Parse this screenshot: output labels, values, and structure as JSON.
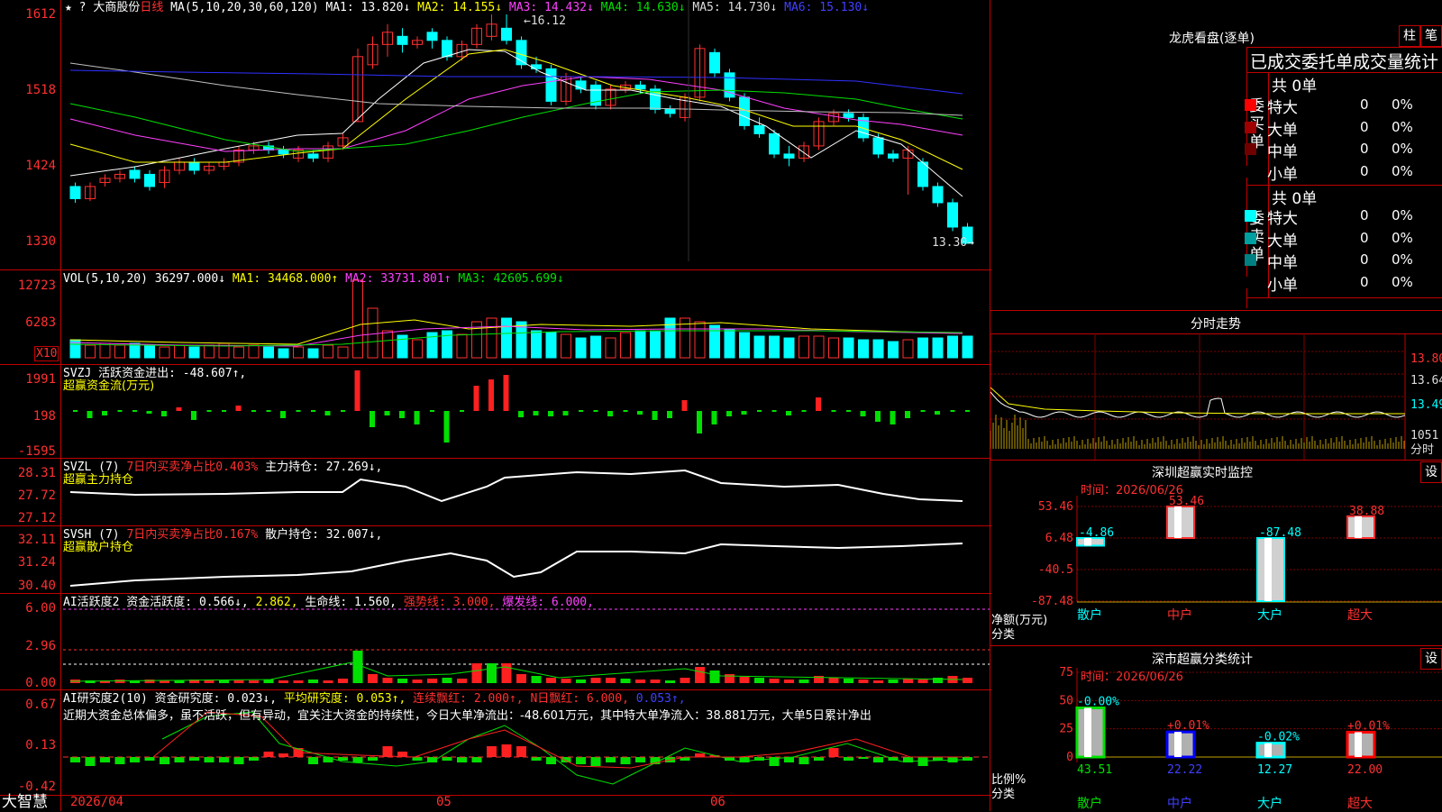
{
  "stock": {
    "name": "大商股份",
    "period": "日线",
    "brand": "大智慧",
    "date_label": "2026/04",
    "month_5": "05",
    "month_6": "06"
  },
  "main": {
    "ma_label": "MA(5,10,20,30,60,120)",
    "ma1": "MA1: 13.820↓",
    "ma2": "MA2: 14.155↓",
    "ma3": "MA3: 14.432↓",
    "ma4": "MA4: 14.630↓",
    "ma5": "MA5: 14.730↓",
    "ma6": "MA6: 15.130↓",
    "axis": [
      "1612",
      "1518",
      "1424",
      "1330"
    ],
    "high_label": "16.12",
    "low_label": "13.30"
  },
  "vol": {
    "label": "VOL(5,10,20)",
    "value": "36297.000↓",
    "ma1": "MA1: 34468.000↑",
    "ma2": "MA2: 33731.801↑",
    "ma3": "MA3: 42605.699↓",
    "axis": [
      "12723",
      "6283"
    ],
    "unit": "X10"
  },
  "svzj": {
    "label": "SVZJ  活跃资金进出: -48.607↑,",
    "sub": "超赢资金流(万元)",
    "axis": [
      "1991",
      "198",
      "-1595"
    ]
  },
  "svzl": {
    "label": "SVZL (7)",
    "desc": "7日内买卖净占比0.403%",
    "value": "主力持仓: 27.269↓,",
    "sub": "超赢主力持仓",
    "axis": [
      "28.31",
      "27.72",
      "27.12"
    ]
  },
  "svsh": {
    "label": "SVSH (7)",
    "desc": "7日内买卖净占比0.167%",
    "value": "散户持仓: 32.007↓,",
    "sub": "超赢散户持仓",
    "axis": [
      "32.11",
      "31.24",
      "30.40"
    ]
  },
  "ai1": {
    "label": "AI活跃度2 资金活跃度: 0.566↓,",
    "v2": "2.862,",
    "life": "生命线: 1.560,",
    "strong": "强势线: 3.000,",
    "burst": "爆发线: 6.000,",
    "axis": [
      "6.00",
      "2.96",
      "0.00"
    ]
  },
  "ai2": {
    "label": "AI研究度2(10) 资金研究度: 0.023↓,",
    "avg": "平均研究度: 0.053↑,",
    "cont": "连续飘红: 2.000↑,",
    "nday": "N日飘红: 6.000,",
    "last": "0.053↑,",
    "axis": [
      "0.67",
      "0.13",
      "-0.42"
    ],
    "comment": "近期大资金总体偏多，虽不活跃，但有异动，宜关注大资金的持续性，今日大单净流出：-48.601万元，其中特大单净流入：38.881万元，大单5日累计净出"
  },
  "dragon": {
    "title": "龙虎看盘(逐单)",
    "btn_pillar": "柱",
    "btn_pen": "笔",
    "heading": "已成交委托单成交量统计",
    "buy_label": "委买单",
    "sell_label": "委卖单",
    "buy_total": "共 0单",
    "sell_total": "共 0单",
    "buy_rows": [
      {
        "name": "特大",
        "count": "0",
        "pct": "0%",
        "color": "#ff0000"
      },
      {
        "name": "大单",
        "count": "0",
        "pct": "0%",
        "color": "#a00000"
      },
      {
        "name": "中单",
        "count": "0",
        "pct": "0%",
        "color": "#700000"
      },
      {
        "name": "小单",
        "count": "0",
        "pct": "0%",
        "color": "#000000"
      }
    ],
    "sell_rows": [
      {
        "name": "特大",
        "count": "0",
        "pct": "0%",
        "color": "#00ffff"
      },
      {
        "name": "大单",
        "count": "0",
        "pct": "0%",
        "color": "#00a0a0"
      },
      {
        "name": "中单",
        "count": "0",
        "pct": "0%",
        "color": "#008080"
      },
      {
        "name": "小单",
        "count": "0",
        "pct": "0%",
        "color": "#000000"
      }
    ]
  },
  "intraday": {
    "title": "分时走势",
    "axis": [
      "13.80",
      "13.64",
      "13.49"
    ],
    "vol_label": "1051",
    "vol_unit": "分时"
  },
  "monitor": {
    "title": "深圳超赢实时监控",
    "btn": "设",
    "time": "时间：2026/06/26",
    "axis": [
      "53.46",
      "6.48",
      "-40.5",
      "-87.48"
    ],
    "y_unit": "净额(万元)",
    "x_unit": "分类",
    "bars": [
      {
        "cat": "散户",
        "value": -4.86,
        "label": "-4.86"
      },
      {
        "cat": "中户",
        "value": 53.46,
        "label": "53.46"
      },
      {
        "cat": "大户",
        "value": -87.48,
        "label": "-87.48"
      },
      {
        "cat": "超大",
        "value": 38.88,
        "label": "38.88"
      }
    ]
  },
  "classstat": {
    "title": "深市超赢分类统计",
    "btn": "设",
    "time": "时间：2026/06/26",
    "axis": [
      "75",
      "50",
      "25",
      "0"
    ],
    "y_unit": "比例%",
    "x_unit": "分类",
    "bars": [
      {
        "cat": "散户",
        "value": 43.51,
        "change": "-0.00%",
        "label": "43.51",
        "color": "#00e000"
      },
      {
        "cat": "中户",
        "value": 22.22,
        "change": "+0.01%",
        "label": "22.22",
        "color": "#0000ff"
      },
      {
        "cat": "大户",
        "value": 12.27,
        "change": "-0.02%",
        "label": "12.27",
        "color": "#00ffff"
      },
      {
        "cat": "超大",
        "value": 22.0,
        "change": "+0.01%",
        "label": "22.00",
        "color": "#ff0000"
      }
    ]
  },
  "chart_data": {
    "type": "bar",
    "title": "大商股份 日线",
    "categories": [
      "散户",
      "中户",
      "大户",
      "超大"
    ],
    "series": [
      {
        "name": "净额(万元)",
        "values": [
          -4.86,
          53.46,
          -87.48,
          38.88
        ]
      },
      {
        "name": "比例%",
        "values": [
          43.51,
          22.22,
          12.27,
          22.0
        ]
      }
    ],
    "ylim": [
      13.3,
      16.12
    ]
  }
}
